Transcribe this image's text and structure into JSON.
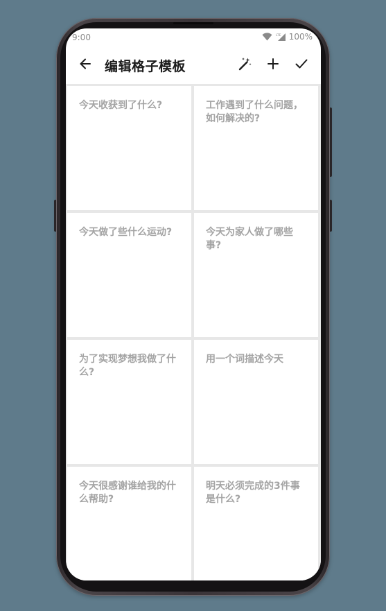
{
  "status": {
    "time": "9:00",
    "battery": "100%"
  },
  "toolbar": {
    "title": "编辑格子模板",
    "icons": [
      "arrow-back-icon",
      "magic-wand-icon",
      "plus-icon",
      "check-icon"
    ]
  },
  "grid": {
    "cells": [
      "今天收获到了什么?",
      "工作遇到了什么问题，如何解决的?",
      "今天做了些什么运动?",
      "今天为家人做了哪些事?",
      "为了实现梦想我做了什么?",
      "用一个词描述今天",
      "今天很感谢谁给我的什么帮助?",
      "明天必须完成的3件事是什么?"
    ]
  },
  "colors": {
    "background": "#5f7b8b",
    "screen": "#ffffff",
    "grid_gap": "#e7e7e7",
    "placeholder_text": "#a4a4a4",
    "title_text": "#1c1c1c"
  }
}
